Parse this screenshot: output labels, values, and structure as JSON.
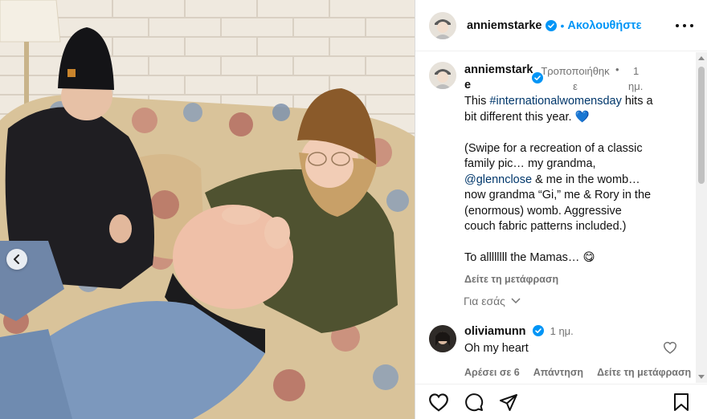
{
  "post": {
    "username": "anniemstarke",
    "follow_label": "Ακολουθήστε",
    "separator": "•"
  },
  "caption": {
    "username_line1": "anniemstark",
    "username_line2": "e",
    "edited_line1": "Τροποποιήθηκ",
    "edited_line2": "ε",
    "time_line1": "1",
    "time_line2": "ημ.",
    "bullet": "•",
    "text_before_tag": "This ",
    "hashtag": "#internationalwomensday",
    "text_after_tag": " hits a bit different this year. 💙",
    "paragraph2_before": "(Swipe for a recreation of a classic family pic… my grandma, ",
    "mention": "@glennclose",
    "paragraph2_after": " & me in the womb… now grandma “Gi,” me & Rory in the (enormous) womb. Aggressive couch fabric patterns included.)",
    "paragraph3": "To allllllll the Mamas… 😋",
    "see_translation": "Δείτε τη μετάφραση"
  },
  "for_you": {
    "label": "Για εσάς"
  },
  "comments": [
    {
      "username": "oliviamunn",
      "time": "1 ημ.",
      "text": "Oh my heart",
      "likes_label": "Αρέσει σε 6",
      "reply_label": "Απάντηση",
      "translate_label": "Δείτε τη μετάφραση"
    }
  ],
  "icons": {
    "verified": "verified-badge-icon",
    "more": "more-options-icon",
    "like": "heart-icon",
    "comment": "comment-icon",
    "share": "share-icon",
    "save": "bookmark-icon",
    "carousel_prev": "chevron-left-icon"
  },
  "colors": {
    "link_blue": "#0095f6",
    "hashtag": "#00376b",
    "muted": "#737373",
    "verified": "#0095f6"
  }
}
